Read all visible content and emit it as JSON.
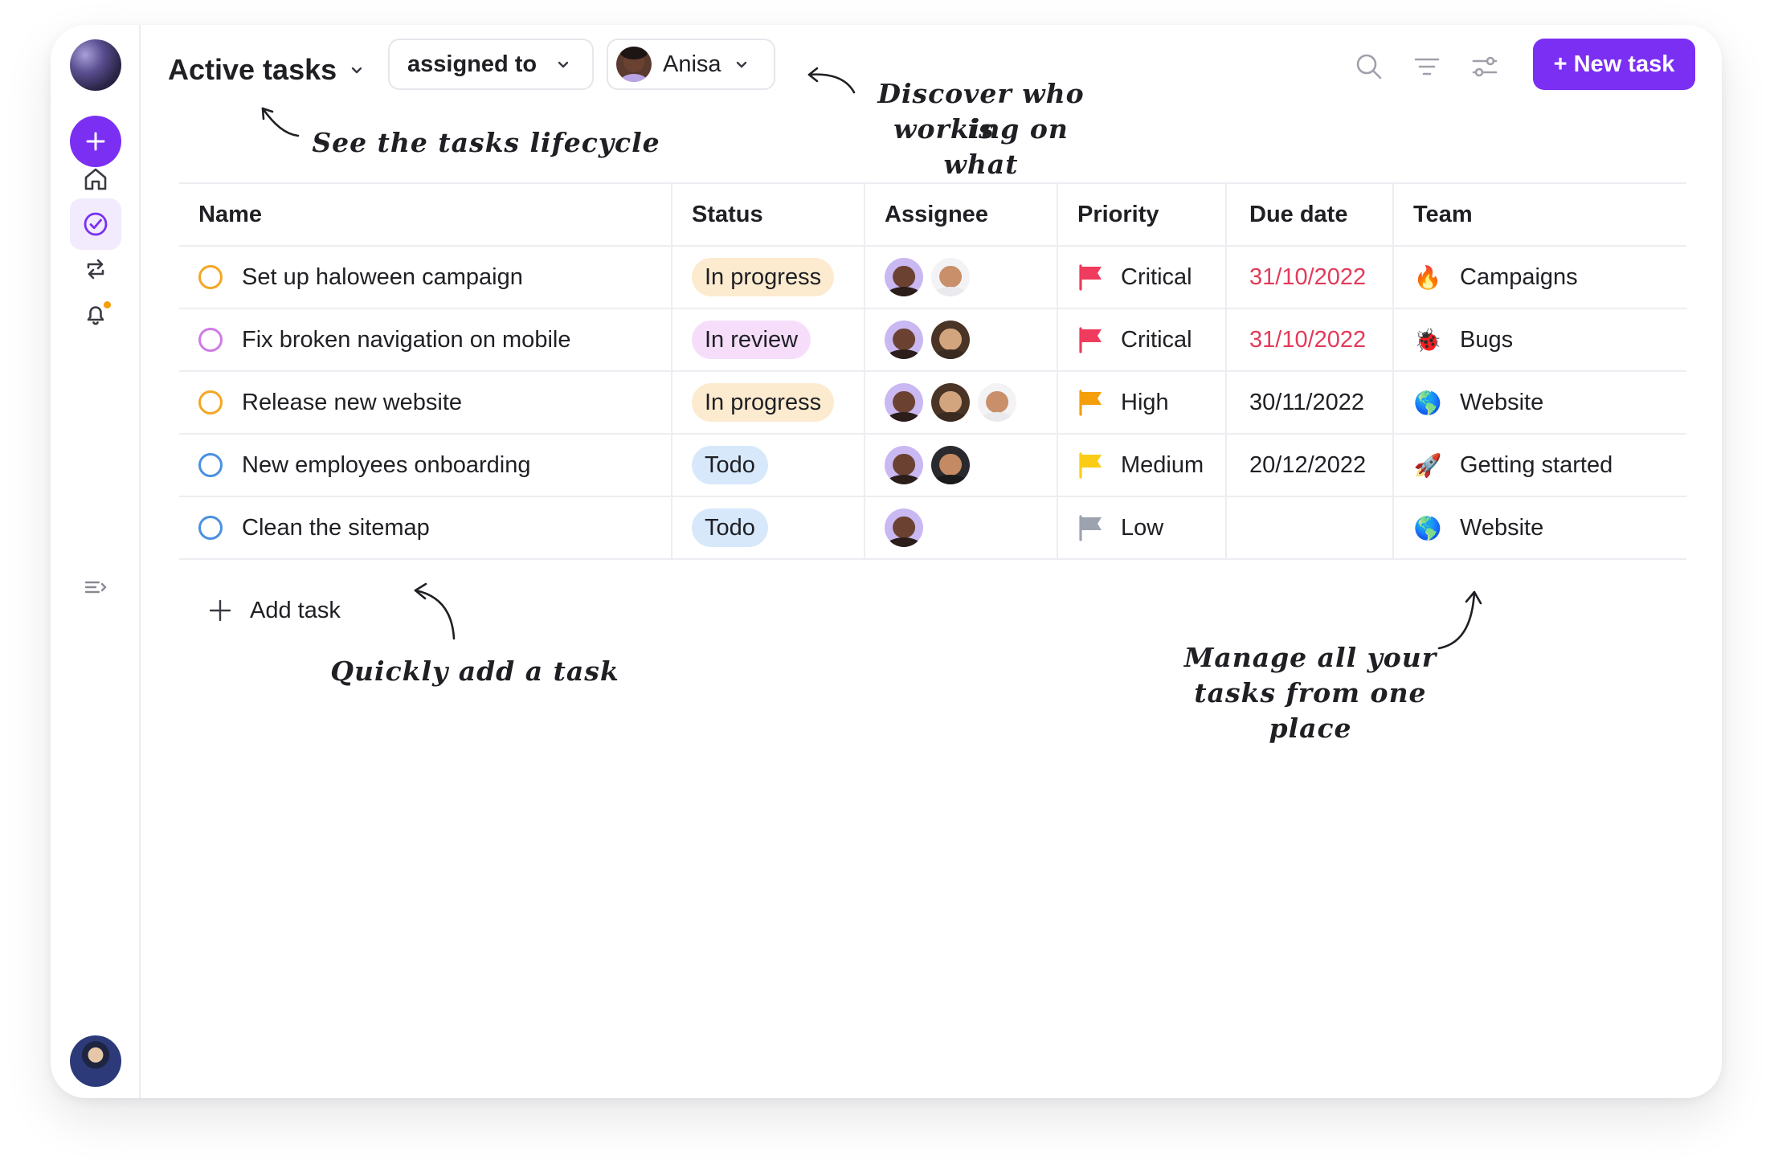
{
  "header": {
    "title": "Active tasks",
    "filter_label": "assigned to",
    "user_label": "Anisa",
    "new_task_label": "+ New task"
  },
  "icons": {
    "sidebar": [
      "avatar",
      "plus-icon",
      "home-icon",
      "tasks-check-icon",
      "repeat-icon",
      "bell-icon",
      "collapse-menu-icon",
      "avatar"
    ],
    "toolbar": [
      "search-icon",
      "filter-icon",
      "sliders-icon"
    ]
  },
  "annotations": {
    "lifecycle": "See the tasks lifecycle",
    "discover_1": "Discover who is",
    "discover_2": "working on what",
    "quick_add": "Quickly add a task",
    "manage_1": "Manage all your",
    "manage_2": "tasks from one place"
  },
  "table": {
    "columns": [
      "Name",
      "Status",
      "Assignee",
      "Priority",
      "Due date",
      "Team"
    ],
    "rows": [
      {
        "name": "Set up haloween campaign",
        "status": "In progress",
        "priority": "Critical",
        "due": "31/10/2022",
        "team": "Campaigns",
        "team_icon": "🔥"
      },
      {
        "name": "Fix broken navigation on mobile",
        "status": "In review",
        "priority": "Critical",
        "due": "31/10/2022",
        "team": "Bugs",
        "team_icon": "🐞"
      },
      {
        "name": "Release new website",
        "status": "In progress",
        "priority": "High",
        "due": "30/11/2022",
        "team": "Website",
        "team_icon": "🌎"
      },
      {
        "name": "New employees onboarding",
        "status": "Todo",
        "priority": "Medium",
        "due": "20/12/2022",
        "team": "Getting started",
        "team_icon": "🚀"
      },
      {
        "name": "Clean the sitemap",
        "status": "Todo",
        "priority": "Low",
        "due": "",
        "team": "Website",
        "team_icon": "🌎"
      }
    ],
    "add_task_label": "Add task"
  },
  "colors": {
    "accent": "#7b2ff2",
    "in_progress_bg": "#fdebd0",
    "in_review_bg": "#f6defb",
    "todo_bg": "#d7e8fb",
    "critical": "#ef3b5d",
    "high": "#f59e0b",
    "medium": "#facc15",
    "low": "#9ca3af",
    "overdue_text": "#e23b5a"
  }
}
